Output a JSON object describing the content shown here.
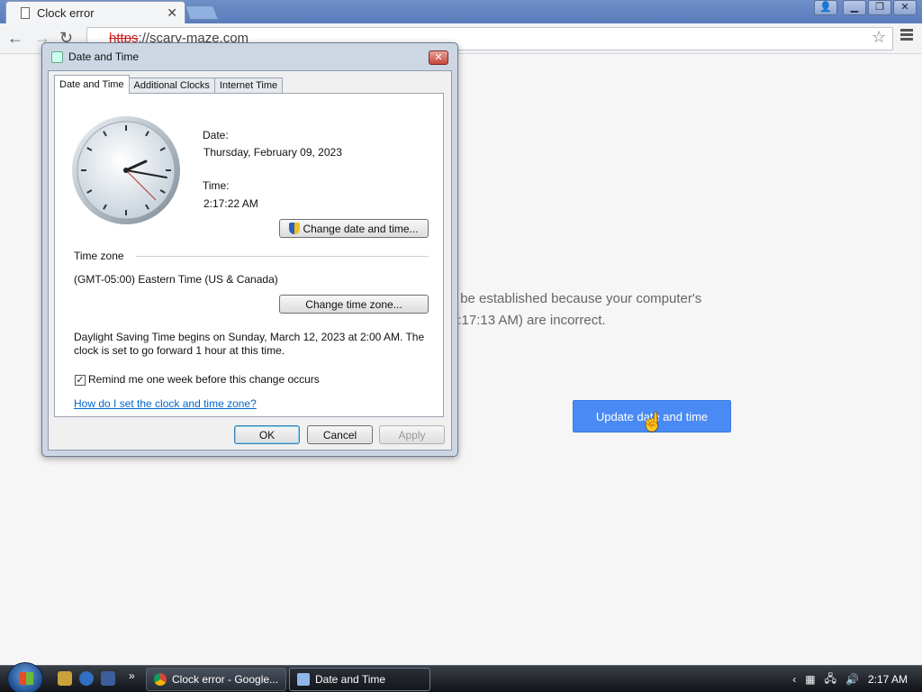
{
  "browser": {
    "tab_title": "Clock error",
    "url_scheme": "https",
    "url_rest": "://scary-maze.com"
  },
  "page": {
    "error_line1": "'t be established because your computer's",
    "error_line2": "2:17:13 AM) are incorrect.",
    "update_button": "Update date and time"
  },
  "dialog": {
    "title": "Date and Time",
    "tabs": [
      "Date and Time",
      "Additional Clocks",
      "Internet Time"
    ],
    "date_label": "Date:",
    "date_value": "Thursday, February 09, 2023",
    "time_label": "Time:",
    "time_value": "2:17:22 AM",
    "change_datetime_button": "Change date and time...",
    "timezone_header": "Time zone",
    "timezone_value": "(GMT-05:00) Eastern Time (US & Canada)",
    "change_timezone_button": "Change time zone...",
    "dst_line1": "Daylight Saving Time begins on Sunday, March 12, 2023 at 2:00 AM. The",
    "dst_line2": "clock is set to go forward 1 hour at this time.",
    "remind_checkbox": "Remind me one week before this change occurs",
    "remind_checked": true,
    "help_link": "How do I set the clock and time zone?",
    "ok_button": "OK",
    "cancel_button": "Cancel",
    "apply_button": "Apply"
  },
  "taskbar": {
    "tasks": [
      "Clock error - Google...",
      "Date and Time"
    ],
    "clock": "2:17 AM"
  },
  "colors": {
    "accent_button": "#4a8af4",
    "link": "#0066cc"
  }
}
